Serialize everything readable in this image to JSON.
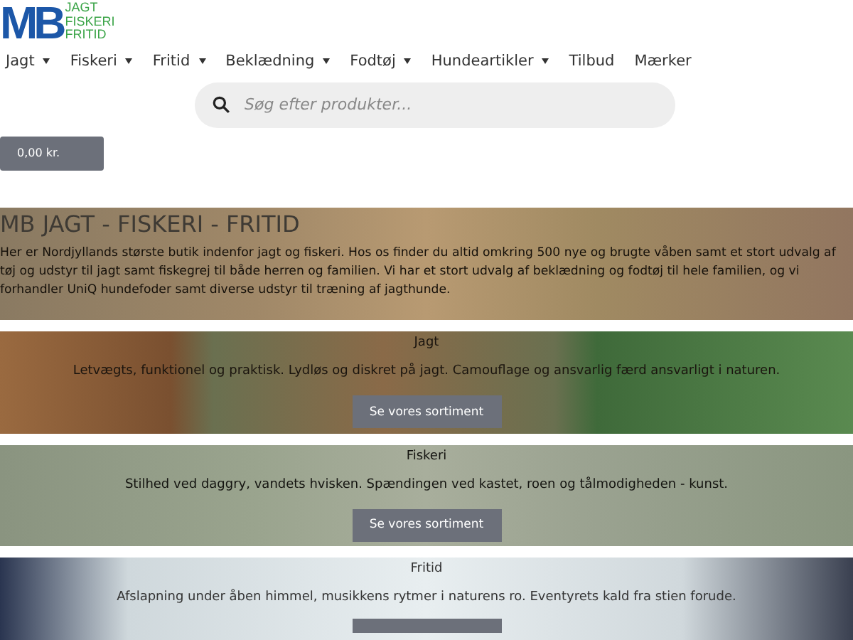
{
  "logo": {
    "mark": "MB",
    "lines": [
      "JAGT",
      "FISKERI",
      "FRITID"
    ]
  },
  "nav": [
    {
      "label": "Jagt",
      "dropdown": true
    },
    {
      "label": "Fiskeri",
      "dropdown": true
    },
    {
      "label": "Fritid",
      "dropdown": true
    },
    {
      "label": "Beklædning",
      "dropdown": true
    },
    {
      "label": "Fodtøj",
      "dropdown": true
    },
    {
      "label": "Hundeartikler",
      "dropdown": true
    },
    {
      "label": "Tilbud",
      "dropdown": false
    },
    {
      "label": "Mærker",
      "dropdown": false
    }
  ],
  "search": {
    "placeholder": "Søg efter produkter..."
  },
  "cart": {
    "total": "0,00 kr."
  },
  "hero": {
    "title": "MB JAGT - FISKERI - FRITID",
    "text": "Her er Nordjyllands største butik indenfor jagt og fiskeri. Hos os finder du altid omkring 500 nye og brugte våben samt et stort udvalg af tøj og udstyr til jagt samt fiskegrej til både herren og familien. Vi har et stort udvalg af beklædning og fodtøj til hele familien, og vi forhandler UniQ hundefoder samt diverse udstyr til træning af jagthunde."
  },
  "sections": [
    {
      "kind": "full",
      "title": "Jagt",
      "text": "Letvægts, funktionel og praktisk. Lydløs og diskret på jagt. Camouflage og ansvarlig færd ansvarligt i naturen.",
      "button": "Se vores sortiment"
    },
    {
      "kind": "full",
      "title": "Fiskeri",
      "text": "Stilhed ved daggry, vandets hvisken. Spændingen ved kastet, roen og tålmodigheden - kunst.",
      "button": "Se vores sortiment"
    },
    {
      "kind": "partial",
      "title": "Fritid",
      "text": "Afslapning under åben himmel, musikkens rytmer i naturens ro. Eventyrets kald fra stien forude."
    }
  ]
}
